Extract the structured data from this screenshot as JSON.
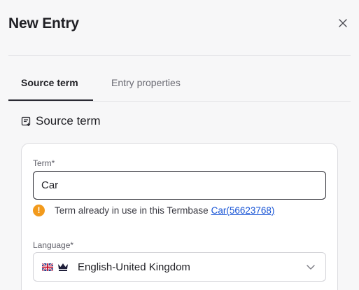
{
  "header": {
    "title": "New Entry",
    "close_icon": "close-icon"
  },
  "tabs": [
    {
      "label": "Source term",
      "active": true
    },
    {
      "label": "Entry properties",
      "active": false
    }
  ],
  "section": {
    "title": "Source term",
    "icon": "note-add-icon"
  },
  "term_field": {
    "label": "Term*",
    "value": "Car"
  },
  "warning": {
    "icon": "warning-icon",
    "text": "Term already in use in this Termbase",
    "link": "Car(56623768)"
  },
  "language_field": {
    "label": "Language*",
    "value": "English-United Kingdom",
    "flag_icon": "uk-flag-icon",
    "crown_icon": "crown-icon"
  },
  "colors": {
    "accent": "#2a2a33",
    "link": "#1a56d6",
    "warning": "#f29a1c"
  }
}
